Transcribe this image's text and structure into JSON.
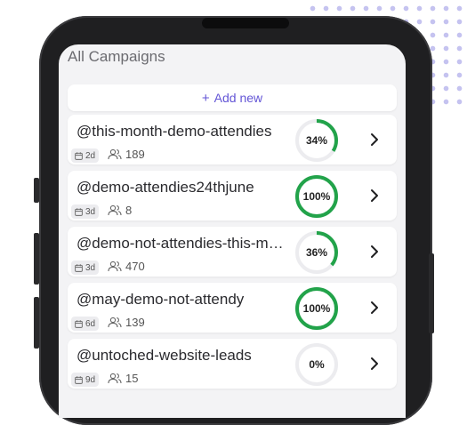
{
  "header": {
    "title": "All Campaigns"
  },
  "actions": {
    "add_new_label": "Add new",
    "add_icon": "+"
  },
  "colors": {
    "accent": "#6355d6",
    "progress": "#22a34a",
    "track": "#ececef"
  },
  "campaigns": [
    {
      "name": "this-month-demo-attendies",
      "age": "2d",
      "users": "189",
      "progress": 34,
      "progress_label": "34%"
    },
    {
      "name": "demo-attendies24thjune",
      "age": "3d",
      "users": "8",
      "progress": 100,
      "progress_label": "100%"
    },
    {
      "name": "demo-not-attendies-this-month",
      "age": "3d",
      "users": "470",
      "progress": 36,
      "progress_label": "36%"
    },
    {
      "name": "may-demo-not-attendy",
      "age": "6d",
      "users": "139",
      "progress": 100,
      "progress_label": "100%"
    },
    {
      "name": "untoched-website-leads",
      "age": "9d",
      "users": "15",
      "progress": 0,
      "progress_label": "0%"
    }
  ]
}
